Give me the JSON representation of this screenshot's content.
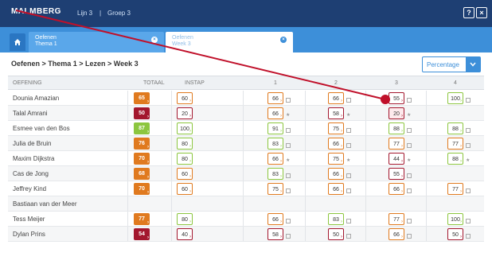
{
  "topbar": {
    "logo": "MALMBERG",
    "nav1": "Lijn 3",
    "separator": "|",
    "nav2": "Groep 3",
    "help_label": "?",
    "close_label": "×"
  },
  "tabs": [
    {
      "title": "Oefenen",
      "subtitle": "Thema 1",
      "close": "×"
    },
    {
      "title": "Oefenen",
      "subtitle": "Week 3",
      "close": "×"
    }
  ],
  "breadcrumb": "Oefenen > Thema 1 > Lezen > Week 3",
  "dropdown": {
    "selected": "Percentage"
  },
  "table": {
    "headers": [
      "OEFENING",
      "TOTAAL",
      "INSTAP",
      "1",
      "2",
      "3",
      "4"
    ],
    "rows": [
      {
        "name": "Dounia Amazian",
        "totaal": "65",
        "instap": "60",
        "c1": "66",
        "c2": "66",
        "c3": "55",
        "c4": "100"
      },
      {
        "name": "Talal Amrani",
        "totaal": "50",
        "instap": "20",
        "c1": "66",
        "c2": "58",
        "c3": "20",
        "c4": ""
      },
      {
        "name": "Esmee van den Bos",
        "totaal": "87",
        "instap": "100",
        "c1": "91",
        "c2": "75",
        "c3": "88",
        "c4": "88"
      },
      {
        "name": "Julia de Bruin",
        "totaal": "76",
        "instap": "80",
        "c1": "83",
        "c2": "66",
        "c3": "77",
        "c4": "77"
      },
      {
        "name": "Maxim Dijkstra",
        "totaal": "70",
        "instap": "80",
        "c1": "66",
        "c2": "75",
        "c3": "44",
        "c4": "88"
      },
      {
        "name": "Cas de Jong",
        "totaal": "68",
        "instap": "60",
        "c1": "83",
        "c2": "66",
        "c3": "55",
        "c4": ""
      },
      {
        "name": "Jeffrey Kind",
        "totaal": "70",
        "instap": "60",
        "c1": "75",
        "c2": "66",
        "c3": "66",
        "c4": "77"
      },
      {
        "name": "Bastiaan van der Meer",
        "totaal": "",
        "instap": "",
        "c1": "",
        "c2": "",
        "c3": "",
        "c4": ""
      },
      {
        "name": "Tess Meijer",
        "totaal": "77",
        "instap": "80",
        "c1": "66",
        "c2": "83",
        "c3": "77",
        "c4": "100"
      },
      {
        "name": "Dylan Prins",
        "totaal": "54",
        "instap": "40",
        "c1": "58",
        "c2": "50",
        "c3": "66",
        "c4": "50"
      }
    ]
  },
  "colors": {
    "navy": "#1e3f73",
    "tabstrip": "#3d8fd9",
    "orange": "#e07a1f",
    "green": "#8cc63f",
    "darkred": "#a3172e",
    "pointer": "#c0102a"
  }
}
